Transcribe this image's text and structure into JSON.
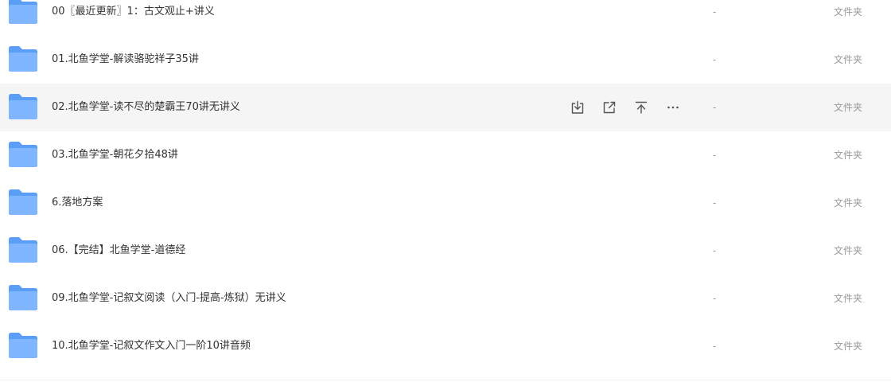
{
  "files": [
    {
      "name": "00〖最近更新〗1：古文观止+讲义",
      "size": "-",
      "type": "文件夹"
    },
    {
      "name": "01.北鱼学堂-解读骆驼祥子35讲",
      "size": "-",
      "type": "文件夹"
    },
    {
      "name": "02.北鱼学堂-读不尽的楚霸王70讲无讲义",
      "size": "-",
      "type": "文件夹"
    },
    {
      "name": "03.北鱼学堂-朝花夕拾48讲",
      "size": "-",
      "type": "文件夹"
    },
    {
      "name": "6.落地方案",
      "size": "-",
      "type": "文件夹"
    },
    {
      "name": "06.【完结】北鱼学堂-道德经",
      "size": "-",
      "type": "文件夹"
    },
    {
      "name": "09.北鱼学堂-记叙文阅读（入门-提高-炼狱）无讲义",
      "size": "-",
      "type": "文件夹"
    },
    {
      "name": "10.北鱼学堂-记叙文作文入门一阶10讲音频",
      "size": "-",
      "type": "文件夹"
    }
  ],
  "row_actions": [
    "download-icon",
    "share-icon",
    "move-to-top-icon",
    "more-icon"
  ],
  "hovered_row": 2,
  "colors": {
    "hover_bg": "#f5f5f6",
    "folder_back": "#5a9ef5",
    "folder_front": "#7fb6ff",
    "muted_text": "#999999",
    "icon": "#555555"
  }
}
